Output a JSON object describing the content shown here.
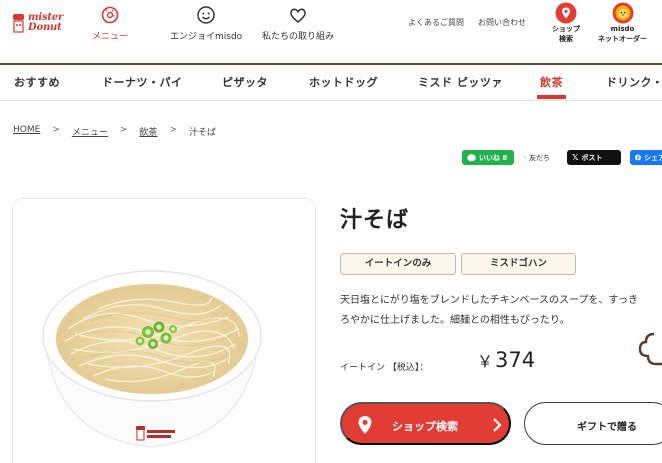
{
  "brand": {
    "logo_line1": "mister",
    "logo_line2": "Donut",
    "accent_color": "#d43a2f"
  },
  "global_nav": {
    "menu": {
      "label": "メニュー",
      "icon": "donut-icon"
    },
    "enjoy": {
      "label": "エンジョイmisdo",
      "icon": "smile-icon"
    },
    "torikumi": {
      "label": "私たちの取り組み",
      "icon": "heart-icon"
    }
  },
  "utility_links": {
    "faq": "よくあるご質問",
    "contact": "お問い合わせ"
  },
  "corner_buttons": {
    "shop_search": {
      "line1": "ショップ",
      "line2": "検索",
      "icon": "map-pin-icon"
    },
    "misdo_order": {
      "line1": "misdo",
      "line2": "ネットオーダー",
      "icon": "pon-de-lion-icon"
    }
  },
  "category_nav": {
    "items": [
      "おすすめ",
      "ドーナツ・パイ",
      "ピザッタ",
      "ホットドッグ",
      "ミスド ピッツァ",
      "飲茶",
      "ドリンク・パイ"
    ],
    "active": "飲茶"
  },
  "breadcrumb": [
    "HOME",
    "メニュー",
    "飲茶",
    "汁そば"
  ],
  "share": {
    "like": "いいね 8",
    "friend": "友だち",
    "post": "ポスト",
    "facebook": "シェア"
  },
  "product": {
    "title": "汁そば",
    "tags": [
      "イートインのみ",
      "ミスドゴハン"
    ],
    "description_line1": "天日塩とにがり塩をブレンドしたチキンベースのスープを、すっき",
    "description_line2": "ろやかに仕上げました。細麺との相性もぴったり。",
    "price_label": "イートイン 【税込】：",
    "price_currency": "￥",
    "price_value": "374",
    "image_icon": "noodle-bowl-image"
  },
  "actions": {
    "shop_search_label": "ショップ検索",
    "gift_label": "ギフトで贈る"
  }
}
